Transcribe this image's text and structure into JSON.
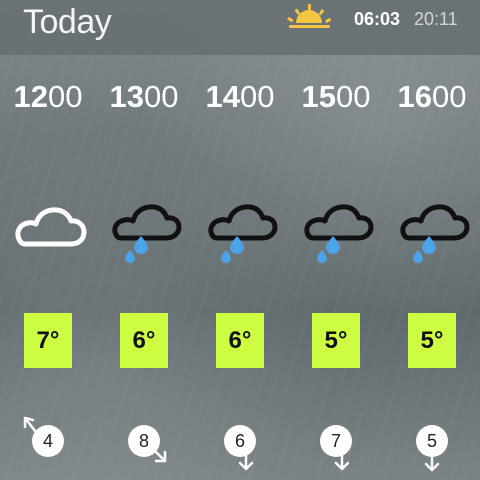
{
  "header": {
    "title": "Today",
    "sun_icon": "sunrise-icon",
    "sunrise_time": "06:03",
    "sunset_time": "20:11"
  },
  "forecast": [
    {
      "hour": {
        "h": "12",
        "m": "00"
      },
      "icon": "cloud-icon",
      "temp": "7°",
      "wind_speed": "4",
      "wind_direction": "northwest"
    },
    {
      "hour": {
        "h": "13",
        "m": "00"
      },
      "icon": "rain-cloud-icon",
      "temp": "6°",
      "wind_speed": "8",
      "wind_direction": "southeast"
    },
    {
      "hour": {
        "h": "14",
        "m": "00"
      },
      "icon": "rain-cloud-icon",
      "temp": "6°",
      "wind_speed": "6",
      "wind_direction": "south"
    },
    {
      "hour": {
        "h": "15",
        "m": "00"
      },
      "icon": "rain-cloud-icon",
      "temp": "5°",
      "wind_speed": "7",
      "wind_direction": "south"
    },
    {
      "hour": {
        "h": "16",
        "m": "00"
      },
      "icon": "rain-cloud-icon",
      "temp": "5°",
      "wind_speed": "5",
      "wind_direction": "south"
    }
  ],
  "colors": {
    "temp_background": "#cdfe41",
    "sun_accent": "#f4c542",
    "rain_drop": "#4da3e8"
  }
}
